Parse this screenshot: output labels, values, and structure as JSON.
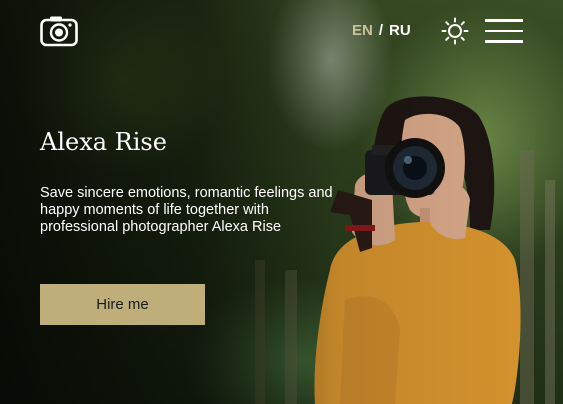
{
  "header": {
    "logo_icon": "camera-icon",
    "lang": {
      "en": "EN",
      "separator": "/",
      "ru": "RU"
    },
    "theme_icon": "sun-icon",
    "menu_icon": "hamburger-menu-icon"
  },
  "hero": {
    "title": "Alexa Rise",
    "description": "Save sincere emotions, romantic feelings and happy moments of life together with professional photographer Alexa Rise",
    "cta_label": "Hire me"
  },
  "colors": {
    "accent": "#bdae7a",
    "lang_active": "#c9c29a",
    "text": "#ffffff"
  }
}
